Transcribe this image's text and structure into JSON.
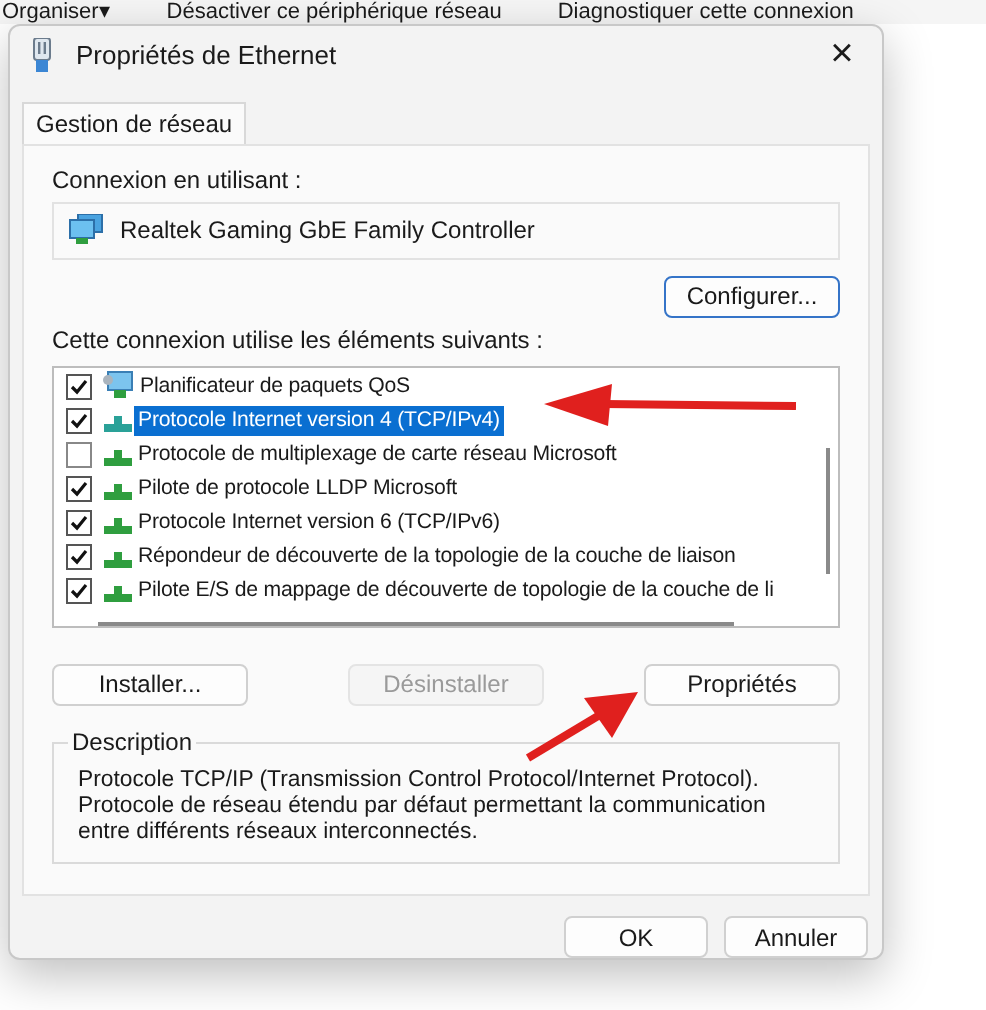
{
  "background_toolbar": {
    "items": [
      {
        "label": "Organiser",
        "caret": "▾"
      },
      {
        "label": "Désactiver ce périphérique réseau"
      },
      {
        "label": "Diagnostiquer cette connexion"
      }
    ]
  },
  "window": {
    "title": "Propriétés de Ethernet",
    "close": "×"
  },
  "tabs": [
    {
      "label": "Gestion de réseau",
      "selected": true
    }
  ],
  "connection_label": "Connexion en utilisant :",
  "adapter": "Realtek Gaming GbE Family Controller",
  "configure_button": "Configurer...",
  "items_label": "Cette connexion utilise les éléments suivants :",
  "items": [
    {
      "label": "Planificateur de paquets QoS",
      "checked": true,
      "selected": false,
      "kind": "service"
    },
    {
      "label": "Protocole Internet version 4 (TCP/IPv4)",
      "checked": true,
      "selected": true,
      "kind": "protocol"
    },
    {
      "label": "Protocole de multiplexage de carte réseau Microsoft",
      "checked": false,
      "selected": false,
      "kind": "protocol"
    },
    {
      "label": "Pilote de protocole LLDP Microsoft",
      "checked": true,
      "selected": false,
      "kind": "protocol"
    },
    {
      "label": "Protocole Internet version 6 (TCP/IPv6)",
      "checked": true,
      "selected": false,
      "kind": "protocol"
    },
    {
      "label": "Répondeur de découverte de la topologie de la couche de liaison",
      "checked": true,
      "selected": false,
      "kind": "protocol"
    },
    {
      "label": "Pilote E/S de mappage de découverte de topologie de la couche de li",
      "checked": true,
      "selected": false,
      "kind": "protocol"
    }
  ],
  "action_buttons": [
    {
      "label": "Installer...",
      "disabled": false
    },
    {
      "label": "Désinstaller",
      "disabled": true
    },
    {
      "label": "Propriétés",
      "disabled": false
    }
  ],
  "description": {
    "legend": "Description",
    "text": "Protocole TCP/IP (Transmission Control Protocol/Internet Protocol). Protocole de réseau étendu par défaut permettant la communication entre différents réseaux interconnectés."
  },
  "buttons": [
    {
      "label": "OK"
    },
    {
      "label": "Annuler"
    }
  ]
}
